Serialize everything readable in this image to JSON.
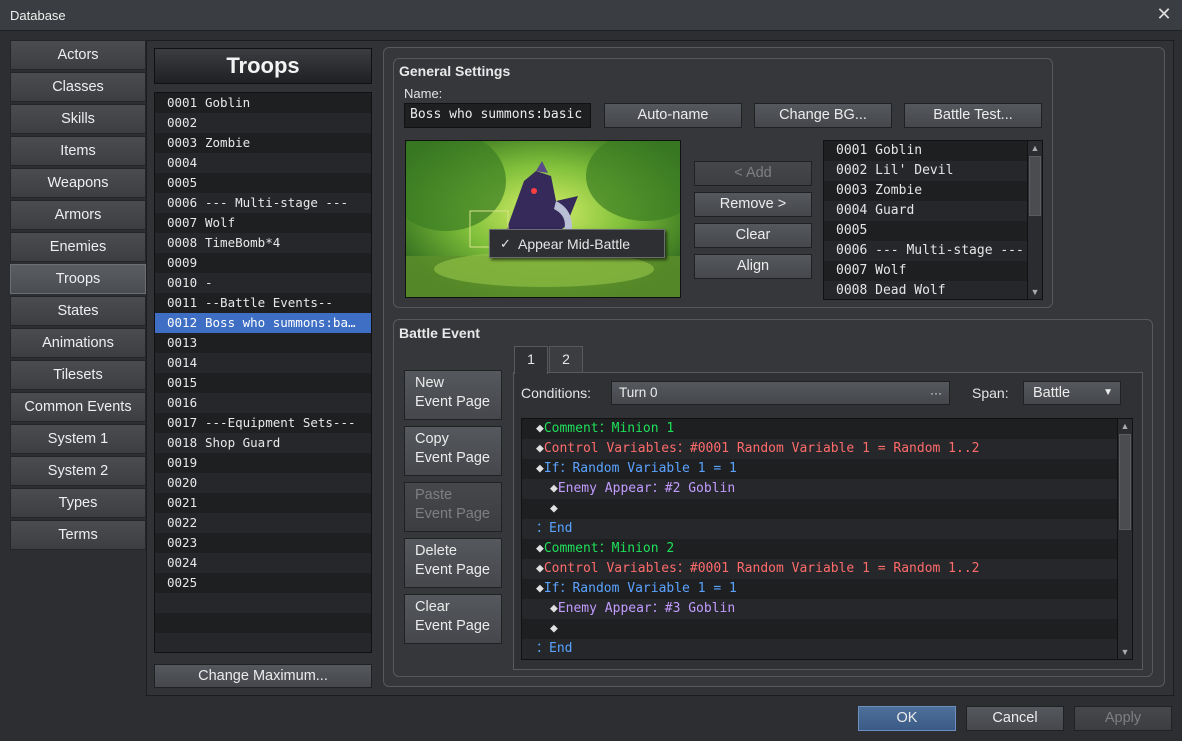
{
  "window": {
    "title": "Database"
  },
  "categories": [
    {
      "label": "Actors"
    },
    {
      "label": "Classes"
    },
    {
      "label": "Skills"
    },
    {
      "label": "Items"
    },
    {
      "label": "Weapons"
    },
    {
      "label": "Armors"
    },
    {
      "label": "Enemies"
    },
    {
      "label": "Troops"
    },
    {
      "label": "States"
    },
    {
      "label": "Animations"
    },
    {
      "label": "Tilesets"
    },
    {
      "label": "Common Events"
    },
    {
      "label": "System 1"
    },
    {
      "label": "System 2"
    },
    {
      "label": "Types"
    },
    {
      "label": "Terms"
    }
  ],
  "troops": {
    "heading": "Troops",
    "items": [
      {
        "num": "0001",
        "name": "Goblin"
      },
      {
        "num": "0002",
        "name": ""
      },
      {
        "num": "0003",
        "name": "Zombie"
      },
      {
        "num": "0004",
        "name": ""
      },
      {
        "num": "0005",
        "name": ""
      },
      {
        "num": "0006",
        "name": "--- Multi-stage ---"
      },
      {
        "num": "0007",
        "name": "Wolf"
      },
      {
        "num": "0008",
        "name": "TimeBomb*4"
      },
      {
        "num": "0009",
        "name": ""
      },
      {
        "num": "0010",
        "name": "-"
      },
      {
        "num": "0011",
        "name": "--Battle Events--"
      },
      {
        "num": "0012",
        "name": "Boss who summons:ba…"
      },
      {
        "num": "0013",
        "name": ""
      },
      {
        "num": "0014",
        "name": ""
      },
      {
        "num": "0015",
        "name": ""
      },
      {
        "num": "0016",
        "name": ""
      },
      {
        "num": "0017",
        "name": "---Equipment Sets---"
      },
      {
        "num": "0018",
        "name": "Shop Guard"
      },
      {
        "num": "0019",
        "name": ""
      },
      {
        "num": "0020",
        "name": ""
      },
      {
        "num": "0021",
        "name": ""
      },
      {
        "num": "0022",
        "name": ""
      },
      {
        "num": "0023",
        "name": ""
      },
      {
        "num": "0024",
        "name": ""
      },
      {
        "num": "0025",
        "name": ""
      }
    ],
    "change_max": "Change Maximum..."
  },
  "general": {
    "title": "General Settings",
    "name_label": "Name:",
    "name_value": "Boss who summons:basic",
    "auto_name": "Auto-name",
    "change_bg": "Change BG...",
    "battle_test": "Battle Test...",
    "context_check": "✓",
    "context_item": "Appear Mid-Battle",
    "add": "< Add",
    "remove": "Remove >",
    "clear": "Clear",
    "align": "Align",
    "members": [
      {
        "text": "0001 Goblin"
      },
      {
        "text": "0002 Lil' Devil"
      },
      {
        "text": "0003 Zombie"
      },
      {
        "text": "0004 Guard"
      },
      {
        "text": "0005"
      },
      {
        "text": "0006 --- Multi-stage ---"
      },
      {
        "text": "0007 Wolf"
      },
      {
        "text": "0008 Dead Wolf"
      }
    ]
  },
  "battle_event": {
    "title": "Battle Event",
    "new_page": [
      "New",
      "Event Page"
    ],
    "copy_page": [
      "Copy",
      "Event Page"
    ],
    "paste_page": [
      "Paste",
      "Event Page"
    ],
    "delete_page": [
      "Delete",
      "Event Page"
    ],
    "clear_page": [
      "Clear",
      "Event Page"
    ],
    "tabs": [
      {
        "label": "1"
      },
      {
        "label": "2"
      }
    ],
    "conditions_label": "Conditions:",
    "conditions_value": "Turn 0",
    "conditions_more": "···",
    "span_label": "Span:",
    "span_value": "Battle",
    "commands": [
      {
        "diamond": "◆",
        "prefix": "",
        "cmd": "Comment：",
        "body": "Minion 1",
        "color": "green",
        "indent": 0
      },
      {
        "diamond": "◆",
        "prefix": "",
        "cmd": "Control Variables：",
        "body": "#0001 Random Variable 1 = Random 1..2",
        "color": "red",
        "indent": 0
      },
      {
        "diamond": "◆",
        "prefix": "",
        "cmd": "If：",
        "body": "Random Variable 1 = 1",
        "color": "blue",
        "indent": 0
      },
      {
        "diamond": "◆",
        "prefix": "",
        "cmd": "Enemy Appear：",
        "body": "#2 Goblin",
        "color": "purple",
        "indent": 1
      },
      {
        "diamond": "◆",
        "prefix": "",
        "cmd": "",
        "body": "",
        "color": "",
        "indent": 1
      },
      {
        "diamond": "",
        "prefix": "：",
        "cmd": "End",
        "body": "",
        "color": "blue",
        "indent": 0
      },
      {
        "diamond": "◆",
        "prefix": "",
        "cmd": "Comment：",
        "body": "Minion 2",
        "color": "green",
        "indent": 0
      },
      {
        "diamond": "◆",
        "prefix": "",
        "cmd": "Control Variables：",
        "body": "#0001 Random Variable 1 = Random 1..2",
        "color": "red",
        "indent": 0
      },
      {
        "diamond": "◆",
        "prefix": "",
        "cmd": "If：",
        "body": "Random Variable 1 = 1",
        "color": "blue",
        "indent": 0
      },
      {
        "diamond": "◆",
        "prefix": "",
        "cmd": "Enemy Appear：",
        "body": "#3 Goblin",
        "color": "purple",
        "indent": 1
      },
      {
        "diamond": "◆",
        "prefix": "",
        "cmd": "",
        "body": "",
        "color": "",
        "indent": 1
      },
      {
        "diamond": "",
        "prefix": "：",
        "cmd": "End",
        "body": "",
        "color": "blue",
        "indent": 0
      }
    ]
  },
  "footer": {
    "ok": "OK",
    "cancel": "Cancel",
    "apply": "Apply"
  }
}
